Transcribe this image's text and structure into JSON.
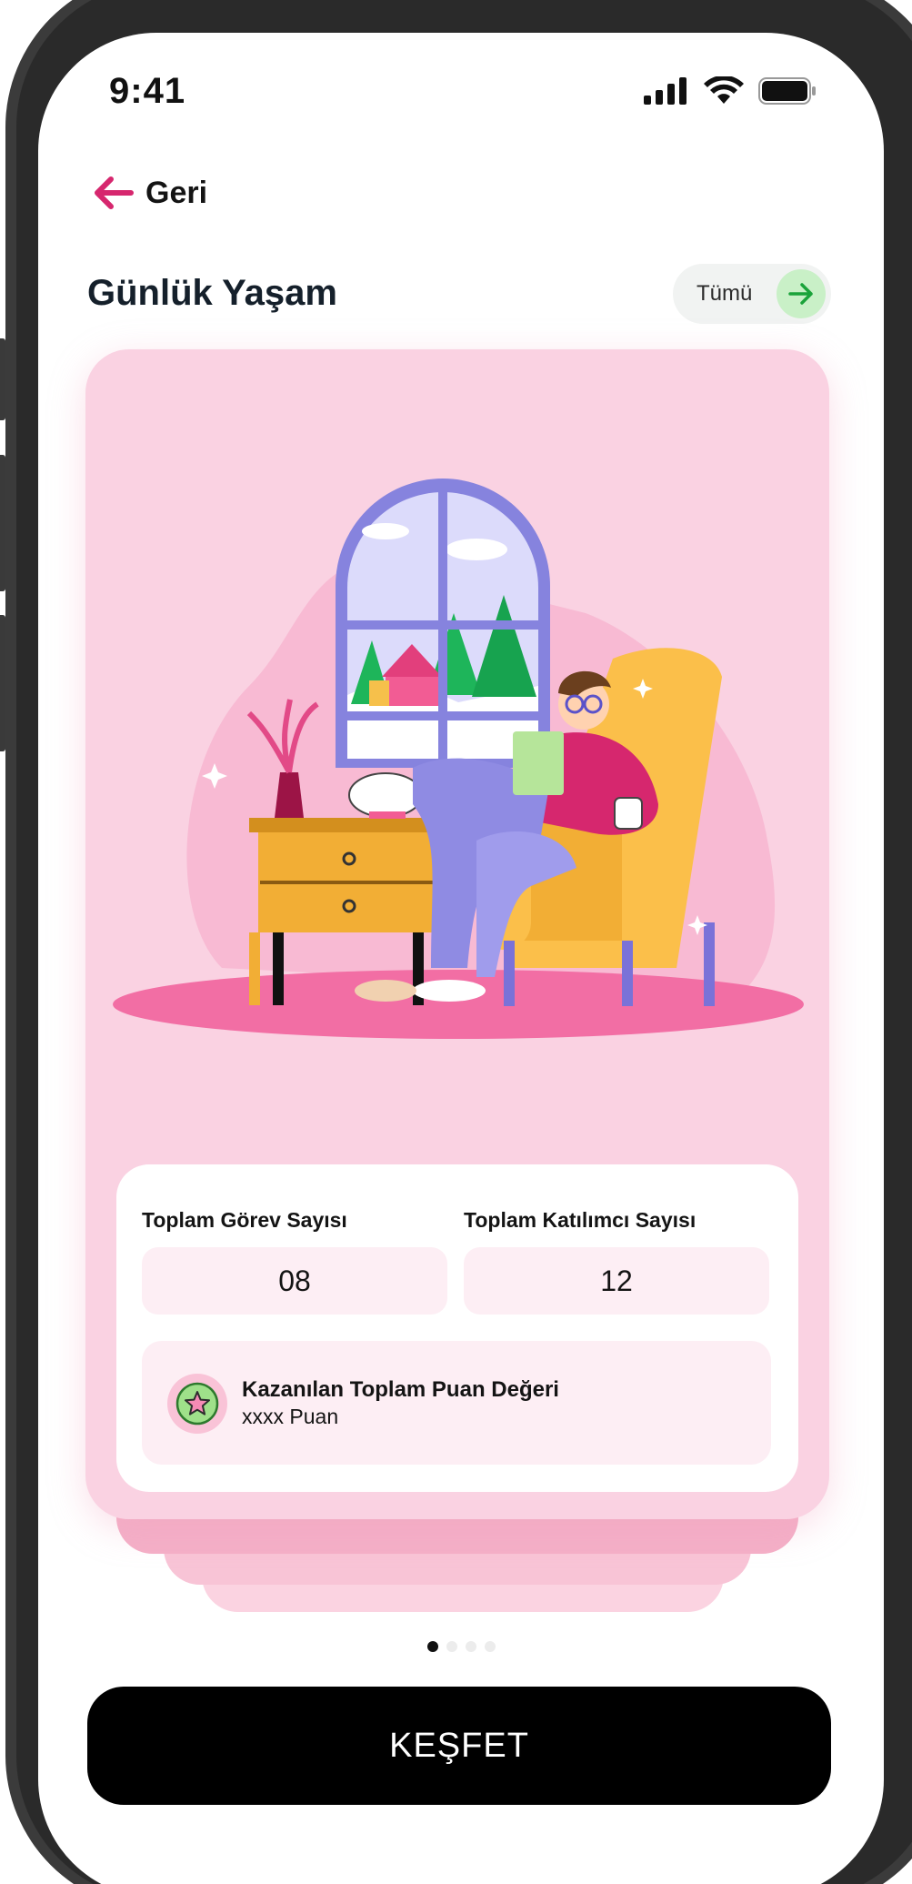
{
  "status_bar": {
    "time": "9:41"
  },
  "header": {
    "back_label": "Geri",
    "title": "Günlük Yaşam",
    "all_label": "Tümü"
  },
  "card": {
    "total_tasks": {
      "label": "Toplam Görev Sayısı",
      "value": "08"
    },
    "total_participants": {
      "label": "Toplam Katılımcı Sayısı",
      "value": "12"
    },
    "points": {
      "title": "Kazanılan Toplam Puan Değeri",
      "value": "xxxx Puan"
    }
  },
  "pager": {
    "count": 4,
    "active_index": 0
  },
  "cta": {
    "label": "KEŞFET"
  },
  "colors": {
    "accent_pink": "#d6276e",
    "card_background": "#fad2e2",
    "cta_background": "#000000",
    "arrow_green": "#1aa33a"
  },
  "icons": [
    "signal-icon",
    "wifi-icon",
    "battery-icon",
    "back-arrow-icon",
    "forward-arrow-icon",
    "star-badge-icon"
  ]
}
